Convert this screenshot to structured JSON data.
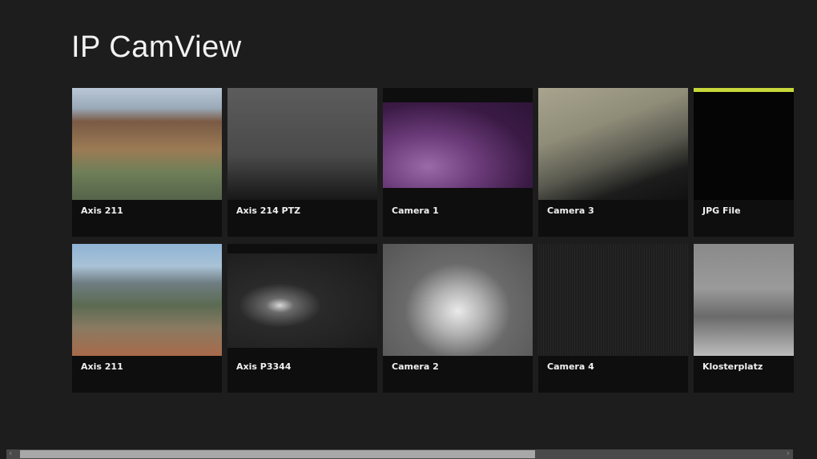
{
  "app": {
    "title": "IP CamView"
  },
  "cameras": [
    {
      "label": "Axis 211"
    },
    {
      "label": "Axis 214 PTZ"
    },
    {
      "label": "Camera 1"
    },
    {
      "label": "Camera 3"
    },
    {
      "label": "JPG File"
    },
    {
      "label": "Axis 211"
    },
    {
      "label": "Axis P3344"
    },
    {
      "label": "Camera 2"
    },
    {
      "label": "Camera 4"
    },
    {
      "label": "Klosterplatz"
    }
  ],
  "scrollbar": {
    "left_arrow": "‹",
    "right_arrow": "›",
    "position_percent": 66
  }
}
